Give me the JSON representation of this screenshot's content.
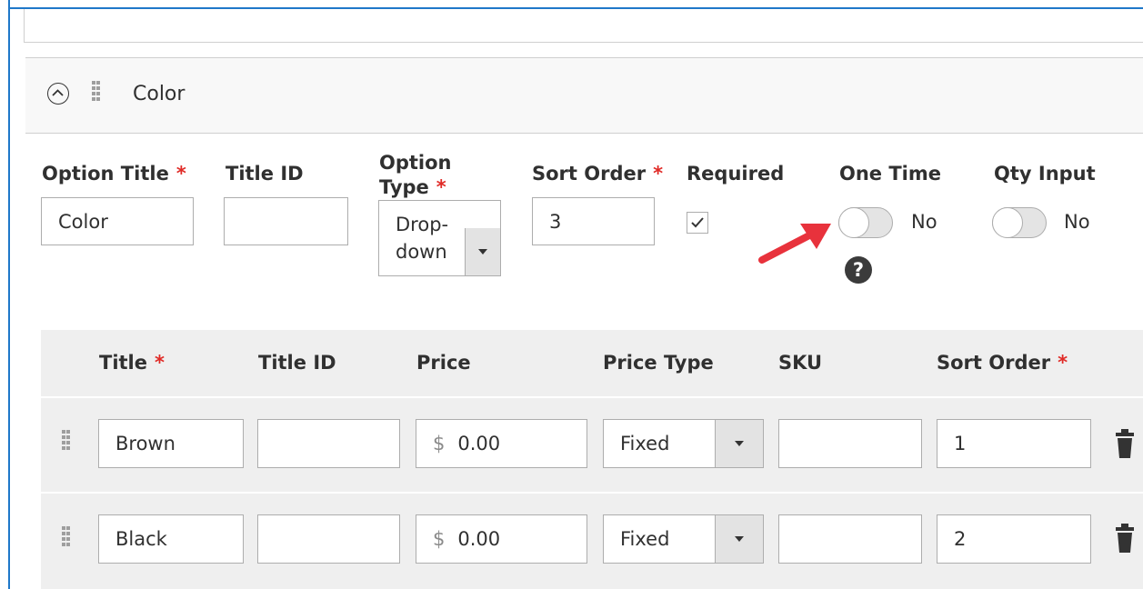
{
  "option": {
    "title": "Color",
    "fields": {
      "option_title": {
        "label": "Option Title",
        "required_mark": "*",
        "value": "Color"
      },
      "title_id": {
        "label": "Title ID",
        "value": ""
      },
      "option_type": {
        "label_line1": "Option",
        "label_line2": "Type",
        "required_mark": "*",
        "value_line1": "Drop-",
        "value_line2": "down"
      },
      "sort_order": {
        "label": "Sort Order",
        "required_mark": "*",
        "value": "3"
      },
      "required": {
        "label": "Required",
        "checked": true
      },
      "one_time": {
        "label": "One Time",
        "toggle_text": "No",
        "help": "?"
      },
      "qty_input": {
        "label": "Qty Input",
        "toggle_text": "No"
      }
    }
  },
  "values_grid": {
    "columns": [
      {
        "label": "Title",
        "required_mark": "*"
      },
      {
        "label": "Title ID",
        "required_mark": ""
      },
      {
        "label": "Price",
        "required_mark": ""
      },
      {
        "label": "Price Type",
        "required_mark": ""
      },
      {
        "label": "SKU",
        "required_mark": ""
      },
      {
        "label": "Sort Order",
        "required_mark": "*"
      }
    ],
    "rows": [
      {
        "title": "Brown",
        "title_id": "",
        "currency": "$",
        "price": "0.00",
        "price_type": "Fixed",
        "sku": "",
        "sort_order": "1"
      },
      {
        "title": "Black",
        "title_id": "",
        "currency": "$",
        "price": "0.00",
        "price_type": "Fixed",
        "sku": "",
        "sort_order": "2"
      }
    ]
  },
  "colors": {
    "frame": "#1f78c9",
    "required": "#e02b27",
    "annotation_arrow": "#e8323c"
  },
  "icons": [
    "chevron-up-icon",
    "drag-handle-icon",
    "checkmark-icon",
    "help-icon",
    "trash-icon",
    "arrow-annotation-icon"
  ]
}
